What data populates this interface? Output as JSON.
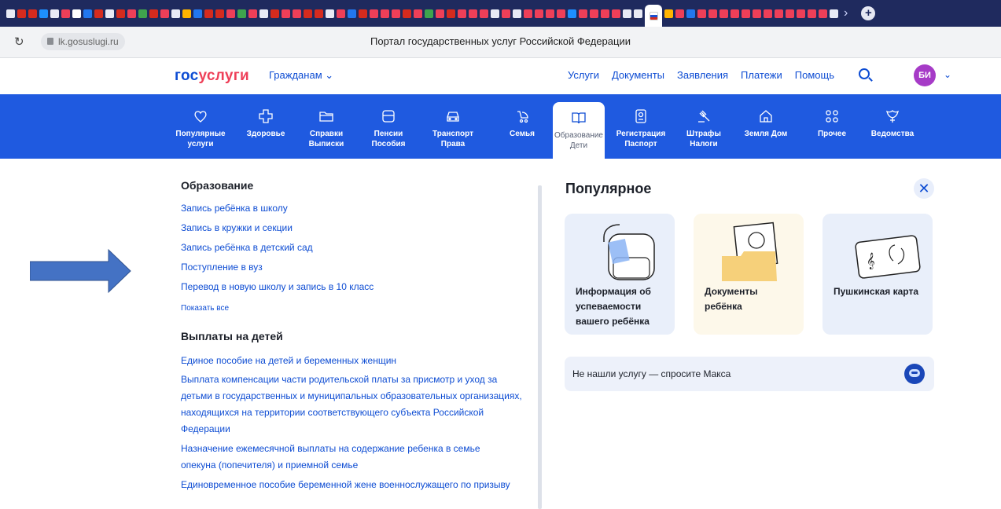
{
  "browser": {
    "tab_icon_colors": [
      "#e8eaf5",
      "#d52b1e",
      "#d52b1e",
      "#1d8fff",
      "#e8eaf5",
      "#ee3f58",
      "#ffffff",
      "#2277ee",
      "#d52b1e",
      "#e8eaf5",
      "#d52b1e",
      "#ee3f58",
      "#3fa34d",
      "#d52b1e",
      "#ee3f58",
      "#e8eaf5",
      "#ffb400",
      "#2277ee",
      "#d52b1e",
      "#d52b1e",
      "#ee3f58",
      "#3fa34d",
      "#ee3f58",
      "#e8eaf5",
      "#d52b1e",
      "#ee3f58",
      "#ee3f58",
      "#d52b1e",
      "#d52b1e",
      "#e8eaf5",
      "#ee3f58",
      "#2277ee",
      "#d52b1e",
      "#ee3f58",
      "#ee3f58",
      "#ee3f58",
      "#d52b1e",
      "#ee3f58",
      "#3fa34d",
      "#ee3f58",
      "#d52b1e",
      "#ee3f58",
      "#ee3f58",
      "#ee3f58",
      "#e8eaf5",
      "#ee3f58",
      "#e8eaf5",
      "#ee3f58",
      "#ee3f58",
      "#ee3f58",
      "#ee3f58",
      "#1d8fff",
      "#ee3f58",
      "#ee3f58",
      "#ee3f58",
      "#ee3f58",
      "#e8eaf5",
      "#e8eaf5",
      "#ffb400",
      "#ee3f58",
      "#2277ee",
      "#ee3f58",
      "#ee3f58",
      "#ee3f58",
      "#ee3f58",
      "#ee3f58",
      "#ee3f58",
      "#ee3f58",
      "#ee3f58",
      "#ee3f58",
      "#ee3f58",
      "#ee3f58",
      "#ee3f58",
      "#e8eaf5"
    ],
    "url": "lk.gosuslugi.ru",
    "page_title": "Портал государственных услуг Российской Федерации"
  },
  "header": {
    "logo_part1": "гос",
    "logo_part2": "услуги",
    "audience": "Гражданам ⌄",
    "nav": [
      "Услуги",
      "Документы",
      "Заявления",
      "Платежи",
      "Помощь"
    ],
    "avatar_initials": "БИ"
  },
  "categories": [
    {
      "label": "Популярные\nуслуги",
      "icon": "heart-icon",
      "active": false
    },
    {
      "label": "Здоровье",
      "icon": "cross-icon",
      "active": false
    },
    {
      "label": "Справки\nВыписки",
      "icon": "folder-icon",
      "active": false
    },
    {
      "label": "Пенсии\nПособия",
      "icon": "wallet-icon",
      "active": false
    },
    {
      "label": "Транспорт\nПрава",
      "icon": "car-icon",
      "active": false
    },
    {
      "label": "Семья",
      "icon": "stroller-icon",
      "active": false
    },
    {
      "label": "Образование\nДети",
      "icon": "book-icon",
      "active": true
    },
    {
      "label": "Регистрация\nПаспорт",
      "icon": "passport-icon",
      "active": false
    },
    {
      "label": "Штрафы\nНалоги",
      "icon": "gavel-icon",
      "active": false
    },
    {
      "label": "Земля Дом",
      "icon": "house-icon",
      "active": false
    },
    {
      "label": "Прочее",
      "icon": "grid-icon",
      "active": false
    },
    {
      "label": "Ведомства",
      "icon": "emblem-icon",
      "active": false
    }
  ],
  "education": {
    "title": "Образование",
    "links": [
      "Запись ребёнка в школу",
      "Запись в кружки и секции",
      "Запись ребёнка в детский сад",
      "Поступление в вуз",
      "Перевод в новую школу и запись в 10 класс"
    ],
    "show_all": "Показать все"
  },
  "payments": {
    "title": "Выплаты на детей",
    "links": [
      "Единое пособие на детей и беременных женщин",
      "Выплата компенсации части родительской платы за присмотр и уход за детьми в государственных и муниципальных образовательных организациях, находящихся на территории соответствующего субъекта Российской Федерации",
      "Назначение ежемесячной выплаты на содержание ребенка в семье опекуна (попечителя) и приемной семье",
      "Единовременное пособие беременной жене военнослужащего по призыву"
    ]
  },
  "popular": {
    "title": "Популярное",
    "cards": [
      "Информация об успеваемости вашего ребёнка",
      "Документы ребёнка",
      "Пушкинская карта"
    ],
    "ask": "Не нашли услугу — спросите Макса"
  },
  "colors": {
    "primary": "#0d4cd3",
    "catbar": "#1f5ae0",
    "accent": "#ee3f58",
    "annotation_arrow": "#4472c4"
  }
}
